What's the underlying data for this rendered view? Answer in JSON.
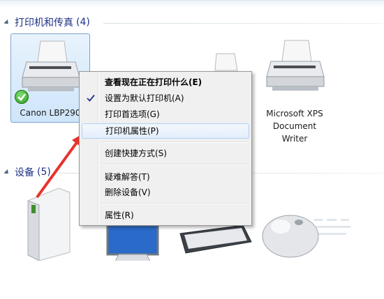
{
  "groups": {
    "printers": {
      "title": "打印机和传真",
      "count": "(4)"
    },
    "devices": {
      "title": "设备",
      "count": "(5)"
    }
  },
  "printers": [
    {
      "label": "Canon LBP290",
      "selected": true,
      "default": true,
      "icon": "printer-icon"
    },
    {
      "label": "Microsoft XPS",
      "label2": "Document",
      "label3": "Writer",
      "icon": "printer-icon"
    }
  ],
  "context_menu": {
    "items": [
      {
        "label": "查看现在正在打印什么(E)",
        "bold": true
      },
      {
        "label": "设置为默认打印机(A)",
        "checked": true
      },
      {
        "label": "打印首选项(G)"
      },
      {
        "label": "打印机属性(P)",
        "highlighted": true
      },
      {
        "label": "创建快捷方式(S)"
      },
      {
        "label": "疑难解答(T)"
      },
      {
        "label": "删除设备(V)"
      },
      {
        "label": "属性(R)"
      }
    ]
  },
  "annotation": {
    "arrow_color": "#e8322b"
  },
  "colors": {
    "group_title": "#1e3287",
    "selection_border": "#7da2ce",
    "menu_bg": "#f0f0f0",
    "hover_border": "#aecff7"
  }
}
